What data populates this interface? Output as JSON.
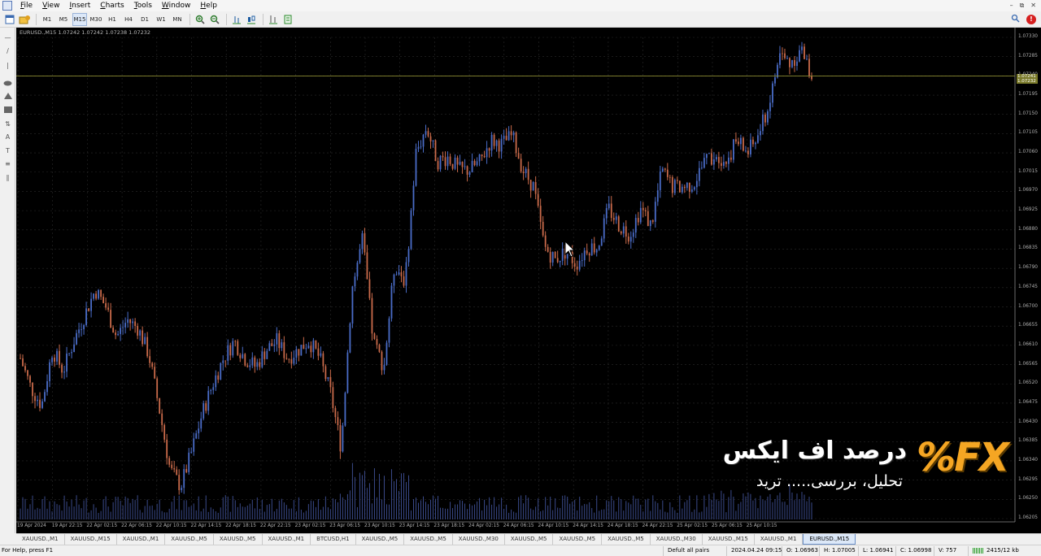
{
  "menu": [
    "File",
    "View",
    "Insert",
    "Charts",
    "Tools",
    "Window",
    "Help"
  ],
  "toolbar": {
    "timeframes": [
      "M1",
      "M5",
      "M15",
      "M30",
      "H1",
      "H4",
      "D1",
      "W1",
      "MN"
    ],
    "active_timeframe": "M15"
  },
  "chart": {
    "label": "EURUSD.,M15  1.07242 1.07242 1.07238 1.07232",
    "symbol": "EURUSD.,M15",
    "colors": {
      "background": "#000000",
      "bull": "#4a6cc7",
      "bear": "#c96a4a",
      "volume": "#3a4a8a",
      "grid": "#2a2a2a",
      "price_line": "#8a8a30"
    },
    "current_price": "1.07232",
    "current_price_tag": "1.07241",
    "price_axis": [
      "1.07330",
      "1.07285",
      "1.07240",
      "1.07195",
      "1.07150",
      "1.07105",
      "1.07060",
      "1.07015",
      "1.06970",
      "1.06925",
      "1.06880",
      "1.06835",
      "1.06790",
      "1.06745",
      "1.06700",
      "1.06655",
      "1.06610",
      "1.06565",
      "1.06520",
      "1.06475",
      "1.06430",
      "1.06385",
      "1.06340",
      "1.06295",
      "1.06250",
      "1.06205"
    ],
    "time_axis": [
      "19 Apr 2024",
      "19 Apr 22:15",
      "22 Apr 02:15",
      "22 Apr 06:15",
      "22 Apr 10:15",
      "22 Apr 14:15",
      "22 Apr 18:15",
      "22 Apr 22:15",
      "23 Apr 02:15",
      "23 Apr 06:15",
      "23 Apr 10:15",
      "23 Apr 14:15",
      "23 Apr 18:15",
      "24 Apr 02:15",
      "24 Apr 06:15",
      "24 Apr 10:15",
      "24 Apr 14:15",
      "24 Apr 18:15",
      "24 Apr 22:15",
      "25 Apr 02:15",
      "25 Apr 06:15",
      "25 Apr 10:15"
    ],
    "chart_data": {
      "type": "candlestick",
      "ylim": [
        1.06205,
        1.0733
      ],
      "close_path": [
        1.0658,
        1.0651,
        1.0647,
        1.066,
        1.0655,
        1.0662,
        1.0668,
        1.0674,
        1.067,
        1.0663,
        1.0667,
        1.0665,
        1.0659,
        1.0646,
        1.0632,
        1.0628,
        1.0636,
        1.0645,
        1.0652,
        1.0658,
        1.0662,
        1.0658,
        1.0656,
        1.066,
        1.0662,
        1.0658,
        1.066,
        1.0662,
        1.0658,
        1.065,
        1.0637,
        1.0674,
        1.0686,
        1.0662,
        1.0656,
        1.068,
        1.0676,
        1.0706,
        1.0712,
        1.0704,
        1.0705,
        1.0702,
        1.0702,
        1.0704,
        1.0709,
        1.0708,
        1.071,
        1.0702,
        1.0698,
        1.0684,
        1.0681,
        1.0683,
        1.068,
        1.0684,
        1.0684,
        1.0693,
        1.0689,
        1.0687,
        1.0693,
        1.0689,
        1.0702,
        1.0698,
        1.0698,
        1.0699,
        1.0704,
        1.0706,
        1.0704,
        1.0709,
        1.0706,
        1.071,
        1.0717,
        1.0729,
        1.0727,
        1.073,
        1.0724
      ]
    }
  },
  "watermark": {
    "title": "درصد اف ایکس",
    "subtitle": "تحلیل، بررسی..... ترید",
    "logo": "%FX"
  },
  "tabs": [
    "XAUUSD.,M1",
    "XAUUSD.,M15",
    "XAUUSD.,M1",
    "XAUUSD.,M5",
    "XAUUSD.,M5",
    "XAUUSD.,M1",
    "BTCUSD,H1",
    "XAUUSD.,M5",
    "XAUUSD.,M5",
    "XAUUSD.,M30",
    "XAUUSD.,M5",
    "XAUUSD.,M5",
    "XAUUSD.,M5",
    "XAUUSD.,M30",
    "XAUUSD.,M15",
    "XAUUSD.,M1",
    "EURUSD.,M15"
  ],
  "active_tab": "EURUSD.,M15",
  "status": {
    "help": "For Help, press F1",
    "profile": "Defult all pairs",
    "datetime": "2024.04.24 09:15",
    "open": "O: 1.06963",
    "high": "H: 1.07005",
    "low": "L: 1.06941",
    "close": "C: 1.06998",
    "volume": "V: 757",
    "traffic": "2415/12 kb"
  }
}
